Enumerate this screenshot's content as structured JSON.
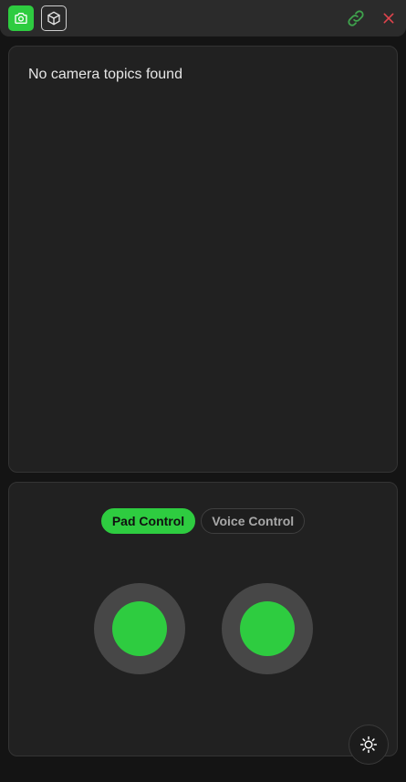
{
  "toolbar": {
    "icons": [
      "camera-icon",
      "cube-icon",
      "link-icon",
      "close-icon"
    ],
    "colors": {
      "accent": "#2ecc40",
      "link": "#3fa34d",
      "close": "#e0444d"
    }
  },
  "camera_panel": {
    "message": "No camera topics found"
  },
  "control_panel": {
    "tabs": [
      {
        "label": "Pad Control",
        "active": true
      },
      {
        "label": "Voice Control",
        "active": false
      }
    ],
    "theme_toggle_icon": "sun-icon"
  }
}
